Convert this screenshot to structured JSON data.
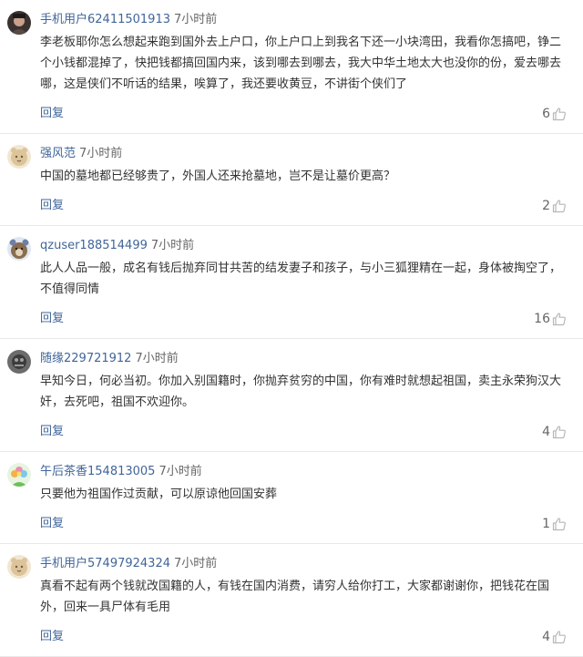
{
  "colors": {
    "username": "#406599",
    "reply": "#406599",
    "text": "#333333",
    "meta": "#666666"
  },
  "comments": [
    {
      "avatar_icon": "portrait-photo-avatar-icon",
      "user": "手机用户62411501913",
      "time": "7小时前",
      "text": "李老板耶你怎么想起来跑到国外去上户口，你上户口上到我名下还一小块湾田，我看你怎搞吧，铮二个小钱都混掉了，快把钱都搞回国内来，该到哪去到哪去，我大中华土地太大也没你的份，爱去哪去哪，这是侠们不听话的结果，唉算了，我还要收黄豆，不讲街个侠们了",
      "reply": "回复",
      "likes": "6"
    },
    {
      "avatar_icon": "default-avatar-icon",
      "user": "强风范",
      "time": "7小时前",
      "text": "中国的墓地都已经够贵了，外国人还来抢墓地，岂不是让墓价更高？",
      "reply": "回复",
      "likes": "2"
    },
    {
      "avatar_icon": "cartoon-avatar-icon",
      "user": "qzuser188514499",
      "time": "7小时前",
      "text": "此人人品一般，成名有钱后抛弃同甘共苦的结发妻子和孩子，与小三狐狸精在一起，身体被掏空了，不值得同情",
      "reply": "回复",
      "likes": "16"
    },
    {
      "avatar_icon": "dark-photo-avatar-icon",
      "user": "随缘229721912",
      "time": "7小时前",
      "text": "早知今日，何必当初。你加入别国籍时，你抛弃贫穷的中国，你有难时就想起祖国，卖主永荣狗汉大奸，去死吧，祖国不欢迎你。",
      "reply": "回复",
      "likes": "4"
    },
    {
      "avatar_icon": "flower-avatar-icon",
      "user": "午后茶香154813005",
      "time": "7小时前",
      "text": "只要他为祖国作过贡献，可以原谅他回国安葬",
      "reply": "回复",
      "likes": "1"
    },
    {
      "avatar_icon": "default-avatar-icon",
      "user": "手机用户57497924324",
      "time": "7小时前",
      "text": "真看不起有两个钱就改国籍的人，有钱在国内消费，请穷人给你打工，大家都谢谢你，把钱花在国外，回来一具尸体有毛用",
      "reply": "回复",
      "likes": "4"
    }
  ]
}
